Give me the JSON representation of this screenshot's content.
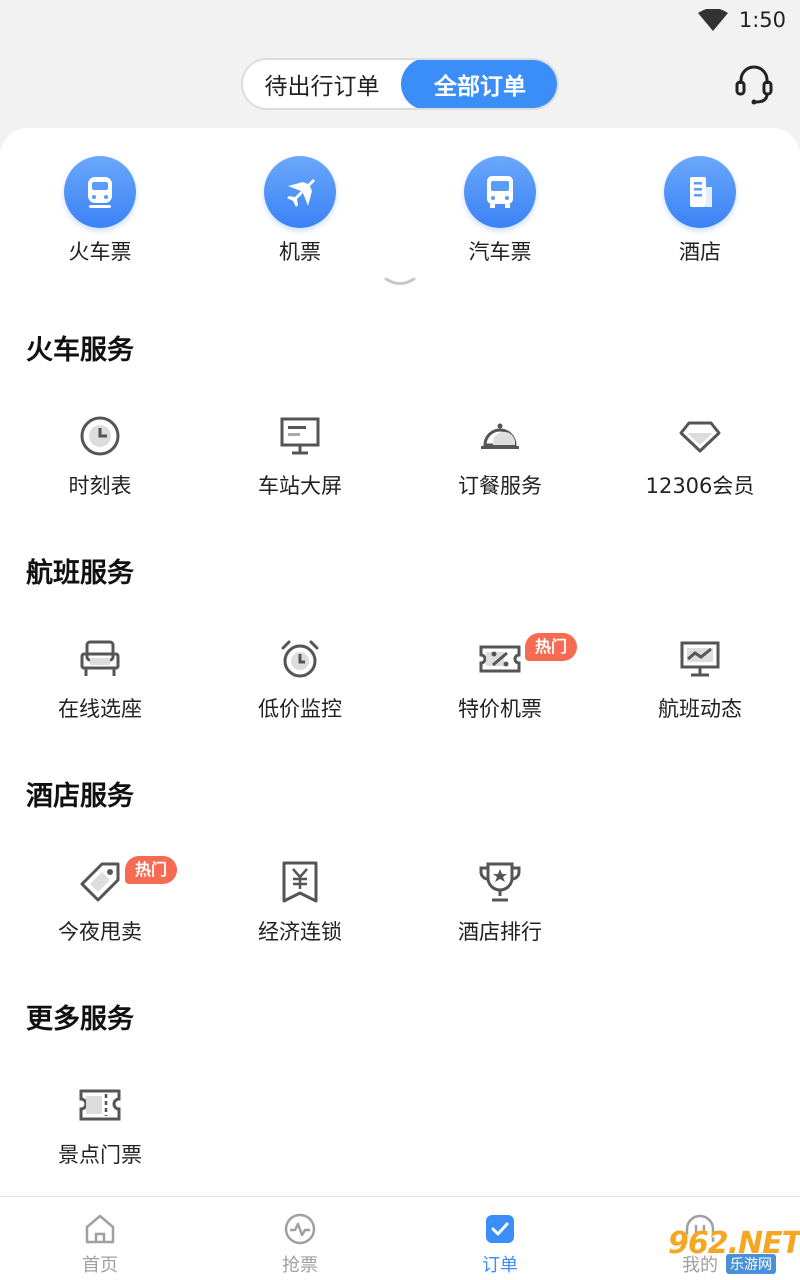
{
  "status_bar": {
    "time": "1:50"
  },
  "header": {
    "segments": [
      {
        "label": "待出行订单",
        "active": false
      },
      {
        "label": "全部订单",
        "active": true
      }
    ]
  },
  "categories": [
    {
      "label": "火车票",
      "icon": "train-icon"
    },
    {
      "label": "机票",
      "icon": "plane-icon"
    },
    {
      "label": "汽车票",
      "icon": "bus-icon"
    },
    {
      "label": "酒店",
      "icon": "hotel-icon"
    }
  ],
  "sections": [
    {
      "title": "火车服务",
      "items": [
        {
          "label": "时刻表",
          "icon": "clock-icon"
        },
        {
          "label": "车站大屏",
          "icon": "screen-icon"
        },
        {
          "label": "订餐服务",
          "icon": "food-cloche-icon"
        },
        {
          "label": "12306会员",
          "icon": "diamond-icon"
        }
      ]
    },
    {
      "title": "航班服务",
      "items": [
        {
          "label": "在线选座",
          "icon": "seat-icon"
        },
        {
          "label": "低价监控",
          "icon": "alarm-clock-icon"
        },
        {
          "label": "特价机票",
          "icon": "discount-ticket-icon",
          "badge": "热门"
        },
        {
          "label": "航班动态",
          "icon": "monitor-chart-icon"
        }
      ]
    },
    {
      "title": "酒店服务",
      "items": [
        {
          "label": "今夜甩卖",
          "icon": "tag-icon",
          "badge": "热门"
        },
        {
          "label": "经济连锁",
          "icon": "yen-bookmark-icon"
        },
        {
          "label": "酒店排行",
          "icon": "trophy-icon"
        }
      ]
    },
    {
      "title": "更多服务",
      "items": [
        {
          "label": "景点门票",
          "icon": "ticket-icon"
        }
      ]
    }
  ],
  "tabbar": [
    {
      "label": "首页",
      "icon": "home-icon",
      "active": false
    },
    {
      "label": "抢票",
      "icon": "pulse-icon",
      "active": false
    },
    {
      "label": "订单",
      "icon": "order-icon",
      "active": true
    },
    {
      "label": "我的",
      "icon": "profile-icon",
      "active": false
    }
  ],
  "watermark": {
    "big": "962.NET",
    "small": "乐游网"
  },
  "colors": {
    "accent": "#3b8df7",
    "badge": "#f76b52",
    "icon_gray": "#555555"
  }
}
